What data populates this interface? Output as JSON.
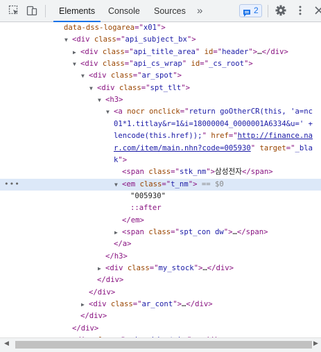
{
  "toolbar": {
    "tabs": [
      "Elements",
      "Console",
      "Sources"
    ],
    "more": "»",
    "issues_count": "2"
  },
  "lines": [
    {
      "indent": 92,
      "parts": [
        [
          "an",
          "data-dss-logarea"
        ],
        [
          "tg",
          "=\""
        ],
        [
          "av",
          "x01"
        ],
        [
          "tg",
          "\">"
        ]
      ]
    },
    {
      "indent": 104,
      "arrow": "down",
      "parts": [
        [
          "tg",
          "<div "
        ],
        [
          "an",
          "class"
        ],
        [
          "tg",
          "=\""
        ],
        [
          "av",
          "api_subject_bx"
        ],
        [
          "tg",
          "\">"
        ]
      ]
    },
    {
      "indent": 116,
      "arrow": "right",
      "parts": [
        [
          "tg",
          "<div "
        ],
        [
          "an",
          "class"
        ],
        [
          "tg",
          "=\""
        ],
        [
          "av",
          "api_title_area"
        ],
        [
          "tg",
          "\" "
        ],
        [
          "an",
          "id"
        ],
        [
          "tg",
          "=\""
        ],
        [
          "av",
          "header"
        ],
        [
          "tg",
          "\">"
        ],
        [
          "tx",
          "…"
        ],
        [
          "tg",
          "</div>"
        ]
      ]
    },
    {
      "indent": 116,
      "arrow": "down",
      "parts": [
        [
          "tg",
          "<div "
        ],
        [
          "an",
          "class"
        ],
        [
          "tg",
          "=\""
        ],
        [
          "av",
          "api_cs_wrap"
        ],
        [
          "tg",
          "\" "
        ],
        [
          "an",
          "id"
        ],
        [
          "tg",
          "=\""
        ],
        [
          "av",
          "_cs_root"
        ],
        [
          "tg",
          "\">"
        ]
      ]
    },
    {
      "indent": 128,
      "arrow": "down",
      "parts": [
        [
          "tg",
          "<div "
        ],
        [
          "an",
          "class"
        ],
        [
          "tg",
          "=\""
        ],
        [
          "av",
          "ar_spot"
        ],
        [
          "tg",
          "\">"
        ]
      ]
    },
    {
      "indent": 140,
      "arrow": "down",
      "parts": [
        [
          "tg",
          "<div "
        ],
        [
          "an",
          "class"
        ],
        [
          "tg",
          "=\""
        ],
        [
          "av",
          "spt_tlt"
        ],
        [
          "tg",
          "\">"
        ]
      ]
    },
    {
      "indent": 152,
      "arrow": "down",
      "parts": [
        [
          "tg",
          "<h3>"
        ]
      ]
    },
    {
      "indent": 164,
      "arrow": "down",
      "parts": [
        [
          "tg",
          "<a "
        ],
        [
          "an",
          "nocr onclick"
        ],
        [
          "tg",
          "=\""
        ],
        [
          "av",
          "return goOtherCR(this, 'a=nc"
        ]
      ]
    },
    {
      "indent": 164,
      "parts": [
        [
          "av",
          "01*1.titlay&r=1&i=18000004_0000001A6334&u=' +"
        ]
      ]
    },
    {
      "indent": 164,
      "parts": [
        [
          "av",
          "lencode(this.href));"
        ],
        [
          "tg",
          "\" "
        ],
        [
          "an",
          "href"
        ],
        [
          "tg",
          "=\""
        ],
        [
          "lk",
          "http://finance.na"
        ]
      ]
    },
    {
      "indent": 164,
      "parts": [
        [
          "lk",
          "r.com/item/main.nhn?code=005930"
        ],
        [
          "tg",
          "\" "
        ],
        [
          "an",
          "target"
        ],
        [
          "tg",
          "=\""
        ],
        [
          "av",
          "_bla"
        ]
      ]
    },
    {
      "indent": 164,
      "parts": [
        [
          "av",
          "k"
        ],
        [
          "tg",
          "\">"
        ]
      ]
    },
    {
      "indent": 176,
      "parts": [
        [
          "tg",
          "<span "
        ],
        [
          "an",
          "class"
        ],
        [
          "tg",
          "=\""
        ],
        [
          "av",
          "stk_nm"
        ],
        [
          "tg",
          "\">"
        ],
        [
          "tx",
          "삼성전자"
        ],
        [
          "tg",
          "</span>"
        ]
      ]
    },
    {
      "indent": 176,
      "arrow": "down",
      "selected": true,
      "parts": [
        [
          "tg",
          "<em "
        ],
        [
          "an",
          "class"
        ],
        [
          "tg",
          "=\""
        ],
        [
          "av",
          "t_nm"
        ],
        [
          "tg",
          "\">"
        ],
        [
          "cm",
          " == "
        ],
        [
          "cm",
          "$0"
        ]
      ]
    },
    {
      "indent": 188,
      "parts": [
        [
          "tx",
          "\"005930\""
        ]
      ]
    },
    {
      "indent": 188,
      "parts": [
        [
          "ps",
          "::after"
        ]
      ]
    },
    {
      "indent": 176,
      "parts": [
        [
          "tg",
          "</em>"
        ]
      ]
    },
    {
      "indent": 176,
      "arrow": "right",
      "parts": [
        [
          "tg",
          "<span "
        ],
        [
          "an",
          "class"
        ],
        [
          "tg",
          "=\""
        ],
        [
          "av",
          "spt_con dw"
        ],
        [
          "tg",
          "\">"
        ],
        [
          "tx",
          "…"
        ],
        [
          "tg",
          "</span>"
        ]
      ]
    },
    {
      "indent": 164,
      "parts": [
        [
          "tg",
          "</a>"
        ]
      ]
    },
    {
      "indent": 152,
      "parts": [
        [
          "tg",
          "</h3>"
        ]
      ]
    },
    {
      "indent": 152,
      "arrow": "right",
      "parts": [
        [
          "tg",
          "<div "
        ],
        [
          "an",
          "class"
        ],
        [
          "tg",
          "=\""
        ],
        [
          "av",
          "my_stock"
        ],
        [
          "tg",
          "\">"
        ],
        [
          "tx",
          "…"
        ],
        [
          "tg",
          "</div>"
        ]
      ]
    },
    {
      "indent": 140,
      "parts": [
        [
          "tg",
          "</div>"
        ]
      ]
    },
    {
      "indent": 128,
      "parts": [
        [
          "tg",
          "</div>"
        ]
      ]
    },
    {
      "indent": 128,
      "arrow": "right",
      "parts": [
        [
          "tg",
          "<div "
        ],
        [
          "an",
          "class"
        ],
        [
          "tg",
          "=\""
        ],
        [
          "av",
          "ar_cont"
        ],
        [
          "tg",
          "\">"
        ],
        [
          "tx",
          "…"
        ],
        [
          "tg",
          "</div>"
        ]
      ]
    },
    {
      "indent": 116,
      "parts": [
        [
          "tg",
          "</div>"
        ]
      ]
    },
    {
      "indent": 104,
      "parts": [
        [
          "tg",
          "</div>"
        ]
      ]
    },
    {
      "indent": 104,
      "arrow": "right",
      "parts": [
        [
          "tg",
          "<div "
        ],
        [
          "an",
          "class"
        ],
        [
          "tg",
          "=\""
        ],
        [
          "av",
          "api_subject_bx"
        ],
        [
          "tg",
          "\">"
        ],
        [
          "tx",
          "…"
        ],
        [
          "tg",
          "</div>"
        ]
      ]
    }
  ],
  "gutter_dots": "•••",
  "colors": {
    "tag": "#881280",
    "attr_name": "#994500",
    "attr_value": "#1a1aa6",
    "selected_bg": "#dce8f8",
    "accent": "#1a73e8"
  },
  "icons": [
    "inspect-element-icon",
    "device-toolbar-icon",
    "more-tabs-icon",
    "issues-icon",
    "settings-gear-icon",
    "more-options-icon",
    "close-icon"
  ]
}
